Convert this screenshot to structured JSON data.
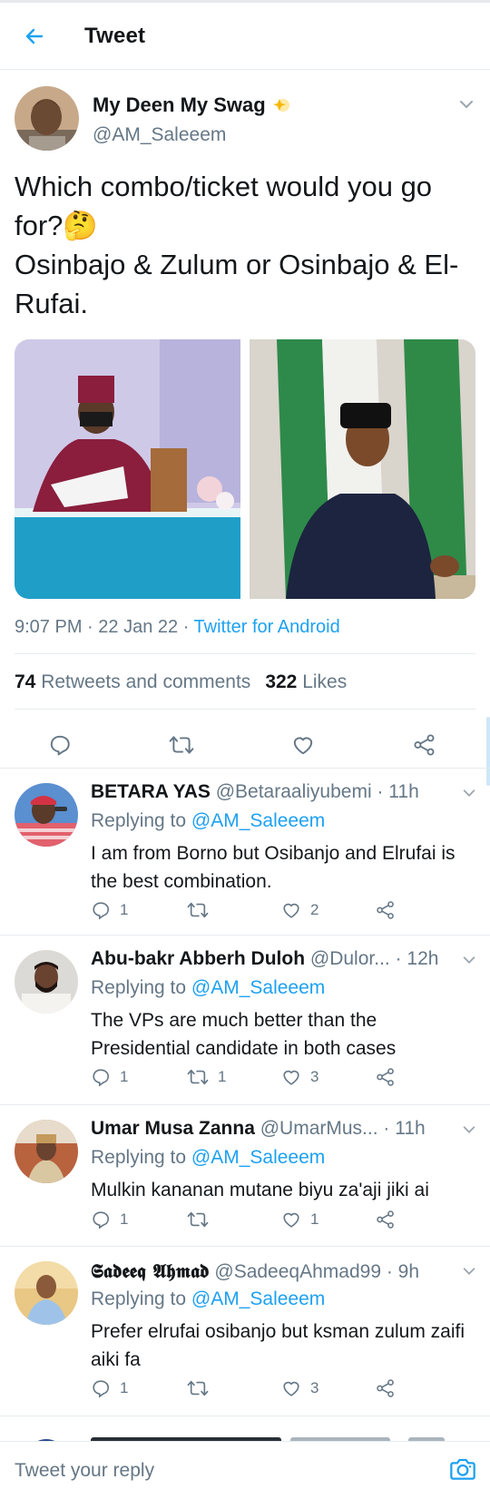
{
  "header": {
    "title": "Tweet"
  },
  "tweet": {
    "author_name": "My Deen My Swag",
    "author_handle": "@AM_Saleeem",
    "text": "Which combo/ticket would you go for?🤔\nOsinbajo & Zulum or Osinbajo & El-Rufai.",
    "time": "9:07 PM",
    "date": "22 Jan 22",
    "source": "Twitter for Android",
    "retweets_count": "74",
    "retweets_label": "Retweets and comments",
    "likes_count": "322",
    "likes_label": "Likes"
  },
  "replies": [
    {
      "name": "BETARA YAS",
      "handle": "@Betaraaliyubemi",
      "time": "11h",
      "replying_label": "Replying to",
      "replying_to": "@AM_Saleeem",
      "text": "I am from Borno but Osibanjo and Elrufai is the best combination.",
      "reply_count": "1",
      "retweet_count": "",
      "like_count": "2"
    },
    {
      "name": "Abu-bakr Abberh Duloh",
      "handle": "@Dulor...",
      "time": "12h",
      "replying_label": "Replying to",
      "replying_to": "@AM_Saleeem",
      "text": "The VPs are much better than the Presidential candidate in both cases",
      "reply_count": "1",
      "retweet_count": "1",
      "like_count": "3"
    },
    {
      "name": "Umar Musa Zanna",
      "handle": "@UmarMus...",
      "time": "11h",
      "replying_label": "Replying to",
      "replying_to": "@AM_Saleeem",
      "text": "Mulkin kananan mutane biyu za'aji jiki ai",
      "reply_count": "1",
      "retweet_count": "",
      "like_count": "1"
    },
    {
      "name": "𝕾𝖆𝖉𝖊𝖊𝖖 𝕬𝖍𝖒𝖆𝖉",
      "handle": "@SadeeqAhmad99",
      "time": "9h",
      "replying_label": "Replying to",
      "replying_to": "@AM_Saleeem",
      "text": "Prefer elrufai osibanjo but ksman zulum zaifi aiki fa",
      "reply_count": "1",
      "retweet_count": "",
      "like_count": "3"
    }
  ],
  "reply_bar": {
    "placeholder": "Tweet your reply"
  },
  "colors": {
    "accent": "#1da1f2",
    "muted": "#657786",
    "text": "#14171a",
    "divider": "#e6ecf0"
  },
  "icons": [
    "back-arrow-icon",
    "sparkle-icon",
    "chevron-down-icon",
    "reply-icon",
    "retweet-icon",
    "like-icon",
    "share-icon",
    "camera-icon"
  ]
}
